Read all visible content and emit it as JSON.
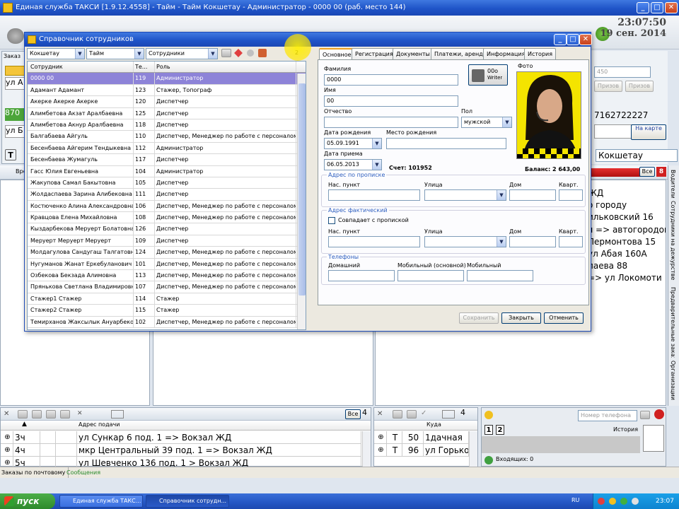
{
  "app": {
    "title": "Единая служба ТАКСИ [1.9.12.4558] - Тайм - Тайм Кокшетау - Администратор - 0000 00 (раб. место 144)",
    "clock_time": "23:07:50",
    "clock_date": "19 сен. 2014"
  },
  "background": {
    "left_panel_items": [
      "Заказ",
      "ул А",
      "870",
      "ул Б"
    ],
    "phone": "7162722227",
    "field_450": "450",
    "btn_prizov1": "Призов",
    "btn_prizov2": "Призов",
    "map_button": "На карте",
    "city": "Кокшетау",
    "all_label": "Все",
    "all_count": "8",
    "right_list": [
      "ЖД",
      "о городу",
      "ильковский 16",
      "я => автогородок",
      "Лермонтова 15",
      "ул Абая 160А",
      "паева 88",
      "=> ул Локомоти"
    ],
    "side_tabs": [
      "Водители",
      "Сотрудники на дежурстве",
      "Предварительные заказы",
      "Организации"
    ],
    "vr_label": "Вре"
  },
  "orders_panel": {
    "all_label": "Все",
    "count": "4",
    "header_address": "Адрес подачи",
    "rows": [
      {
        "time": "3ч",
        "address": "ул Сункар 6 под. 1 => Вокзал ЖД"
      },
      {
        "time": "4ч",
        "address": "мкр Центральный 39 под. 1 => Вокзал ЖД"
      },
      {
        "time": "5ч",
        "address": "ул Шевченко 136 под. 1   > Вокзал ЖД"
      }
    ]
  },
  "cars_panel": {
    "count": "4",
    "header_where": "Куда",
    "rows": [
      {
        "t": "Т",
        "num": "50",
        "where": "1дачная"
      },
      {
        "t": "Т",
        "num": "96",
        "where": "ул Горько"
      }
    ]
  },
  "phone_panel": {
    "placeholder": "Номер телефона",
    "line1": "1",
    "line2": "2",
    "history": "История",
    "incoming": "Входящих: 0"
  },
  "statusbar": {
    "tab1": "Заказы по почтовому",
    "tab2": "Сообщения"
  },
  "taskbar": {
    "start": "пуск",
    "task1": "Единая служба ТАКС...",
    "task2": "Справочник сотрудн...",
    "lang": "RU",
    "time": "23:07"
  },
  "dialog": {
    "title": "Справочник сотрудников",
    "filter_city": "Кокшетау",
    "filter_company": "Тайм",
    "filter_type": "Сотрудники",
    "count_label": "2",
    "tabs": [
      "Основное",
      "Регистрация",
      "Документы",
      "Платежи, аренда",
      "Информация",
      "История"
    ],
    "grid_headers": {
      "name": "Сотрудник",
      "num": "Те...",
      "role": "Роль"
    },
    "employees": [
      {
        "name": "0000 00",
        "num": "119",
        "role": "Администратор"
      },
      {
        "name": "Адамант Адамант",
        "num": "123",
        "role": "Стажер, Топограф"
      },
      {
        "name": "Акерке Акерке Акерке",
        "num": "120",
        "role": "Диспетчер"
      },
      {
        "name": "Алимбетова Акзат Аралбаевна",
        "num": "125",
        "role": "Диспетчер"
      },
      {
        "name": "Алимбетова Акнур Аралбаевна",
        "num": "118",
        "role": "Диспетчер"
      },
      {
        "name": "Балгабаева Айгуль",
        "num": "110",
        "role": "Диспетчер, Менеджер по работе с персоналом, Рег..."
      },
      {
        "name": "Бесенбаева Айгерим Тендыкевна",
        "num": "112",
        "role": "Администратор"
      },
      {
        "name": "Бесенбаева Жумагуль",
        "num": "117",
        "role": "Диспетчер"
      },
      {
        "name": "Гасс Юлия Евгеньевна",
        "num": "104",
        "role": "Администратор"
      },
      {
        "name": "Жакупова Самал Бакытовна",
        "num": "105",
        "role": "Диспетчер"
      },
      {
        "name": "Жолдаспаева Зарина Алибековна",
        "num": "111",
        "role": "Диспетчер"
      },
      {
        "name": "Костюченко Алина Александровна",
        "num": "106",
        "role": "Диспетчер, Менеджер по работе с персоналом, Рег..."
      },
      {
        "name": "Кравцова Елена Михайловна",
        "num": "108",
        "role": "Диспетчер, Менеджер по работе с персоналом, Рег..."
      },
      {
        "name": "Кыздарбекова Меруерт Болатовна",
        "num": "126",
        "role": "Диспетчер"
      },
      {
        "name": "Меруерт Меруерт Меруерт",
        "num": "109",
        "role": "Диспетчер"
      },
      {
        "name": "Молдагулова Сандугаш Талгатовна",
        "num": "124",
        "role": "Диспетчер, Менеджер по работе с персоналом, Рег..."
      },
      {
        "name": "Нугуманов Жанат Еркебуланович",
        "num": "101",
        "role": "Диспетчер, Менеджер по работе с персоналом, Рег..."
      },
      {
        "name": "Озбекова Бекзада Алимовна",
        "num": "113",
        "role": "Диспетчер, Менеджер по работе с персоналом, Рег..."
      },
      {
        "name": "Прянькова Светлана Владимировна",
        "num": "107",
        "role": "Диспетчер, Менеджер по работе с персоналом, Рег..."
      },
      {
        "name": "Стажер1 Стажер",
        "num": "114",
        "role": "Стажер"
      },
      {
        "name": "Стажер2 Стажер",
        "num": "115",
        "role": "Стажер"
      },
      {
        "name": "Темирханов Жаксылык Ануарбеко...",
        "num": "102",
        "role": "Диспетчер, Менеджер по работе с персоналом, Рег..."
      }
    ],
    "form": {
      "surname_label": "Фамилия",
      "surname": "0000",
      "name_label": "Имя",
      "name": "00",
      "patronymic_label": "Отчество",
      "patronymic": "",
      "gender_label": "Пол",
      "gender": "мужской",
      "birth_label": "Дата рождения",
      "birth": "05.09.1991",
      "birthplace_label": "Место рождения",
      "birthplace": "",
      "hire_label": "Дата приема",
      "hire": "06.05.2013",
      "account": "Счет: 101952",
      "balance": "Баланс: 2 643,00",
      "photo_label": "Фото",
      "writer_label": "00о",
      "writer_sub": "Writer",
      "reg_address": "Адрес по прописке",
      "settlement": "Нас. пункт",
      "street": "Улица",
      "house": "Дом",
      "apt": "Кварт.",
      "actual_address": "Адрес фактический",
      "same_as_reg": "Совпадает с пропиской",
      "phones": "Телефоны",
      "home_phone": "Домашний",
      "mobile_main": "Мобильный (основной)",
      "mobile": "Мобильный",
      "save": "Сохранить",
      "close": "Закрыть",
      "cancel": "Отменить"
    }
  }
}
